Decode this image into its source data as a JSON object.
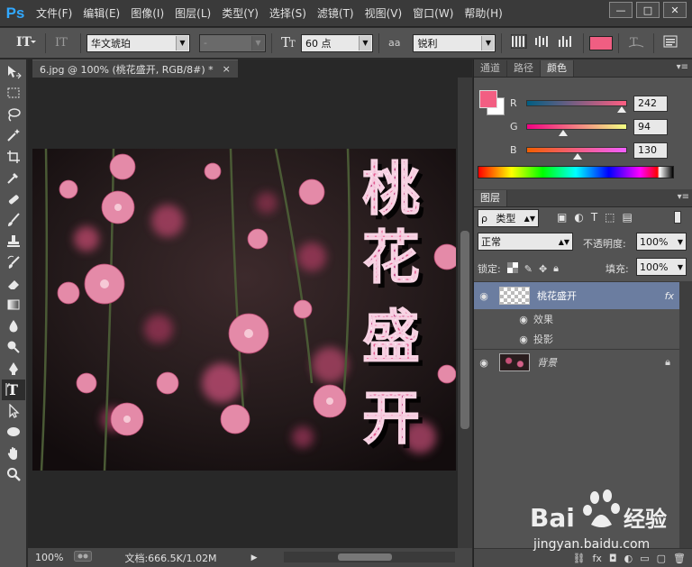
{
  "app": {
    "logo": "Ps"
  },
  "menu": [
    "文件(F)",
    "编辑(E)",
    "图像(I)",
    "图层(L)",
    "类型(Y)",
    "选择(S)",
    "滤镜(T)",
    "视图(V)",
    "窗口(W)",
    "帮助(H)"
  ],
  "window_controls": {
    "minimize": "—",
    "restore": "□",
    "close": "✕"
  },
  "options": {
    "font_family": "华文琥珀",
    "font_style": "-",
    "font_size": "60 点",
    "aa_icon": "aa",
    "antialias": "锐利",
    "text_color": "#f05e82"
  },
  "document": {
    "tab_title": "6.jpg @ 100% (桃花盛开, RGB/8#) *",
    "tab_close": "×",
    "zoom": "100%",
    "doc_info": "文档:666.5K/1.02M",
    "canvas_text": [
      "桃",
      "花",
      "盛",
      "开"
    ]
  },
  "color_panel": {
    "tabs": [
      "通道",
      "路径",
      "颜色"
    ],
    "active_tab": "颜色",
    "foreground": "#f25e82",
    "background": "#ffffff",
    "channels": [
      {
        "label": "R",
        "value": "242",
        "fraction": 0.949
      },
      {
        "label": "G",
        "value": "94",
        "fraction": 0.369
      },
      {
        "label": "B",
        "value": "130",
        "fraction": 0.51
      }
    ]
  },
  "layers_panel": {
    "tab": "图层",
    "filter_kind": "类型",
    "blend_mode": "正常",
    "opacity_label": "不透明度:",
    "opacity": "100%",
    "lock_label": "锁定:",
    "fill_label": "填充:",
    "fill": "100%",
    "layers": [
      {
        "name": "桃花盛开",
        "fx": "fx",
        "effects_label": "效果",
        "effect": "投影"
      },
      {
        "name": "背景"
      }
    ]
  },
  "watermark": {
    "brand": "Baidu",
    "brand_cn": "经验",
    "url": "jingyan.baidu.com"
  }
}
